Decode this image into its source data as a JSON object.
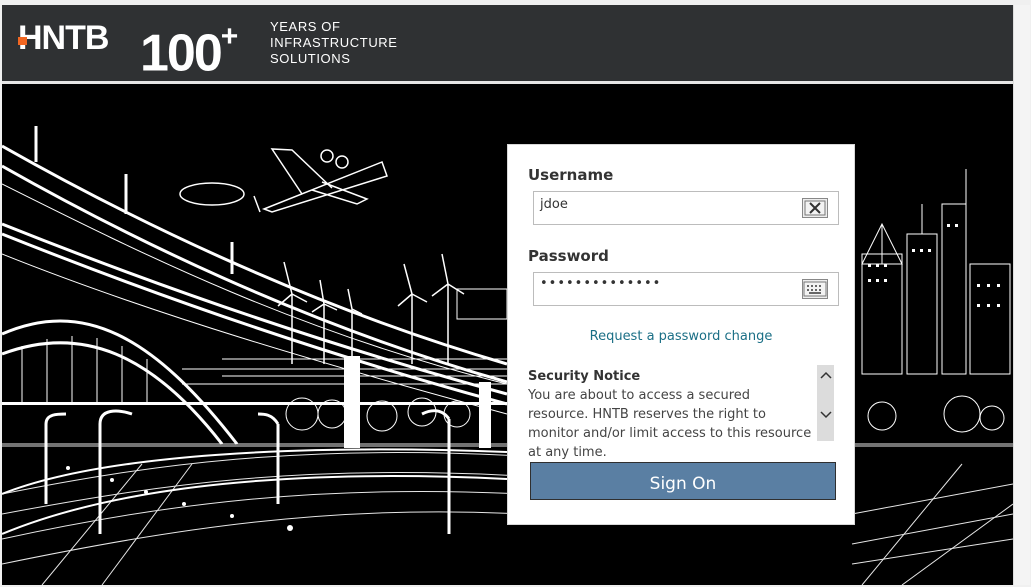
{
  "header": {
    "logo_text": "HNTB",
    "hundred": "100",
    "plus": "+",
    "tagline_line1": "YEARS OF",
    "tagline_line2": "INFRASTRUCTURE",
    "tagline_line3": "SOLUTIONS"
  },
  "login": {
    "username_label": "Username",
    "username_value": "jdoe",
    "password_label": "Password",
    "password_value": "••••••••••••••",
    "password_change_link": "Request a password change",
    "notice_title": "Security Notice",
    "notice_text": "You are about to access a secured resource. HNTB reserves the right to monitor and/or limit access to this resource at any time.",
    "sign_on_label": "Sign On"
  },
  "icons": {
    "username_field": "clear-icon",
    "password_field": "keyboard-icon",
    "notice_scroll_up": "chevron-up-icon",
    "notice_scroll_down": "chevron-down-icon"
  },
  "colors": {
    "header_bg": "#2f3133",
    "accent": "#f26722",
    "sign_on_bg": "#5a7fa3",
    "link": "#1b6f86"
  }
}
